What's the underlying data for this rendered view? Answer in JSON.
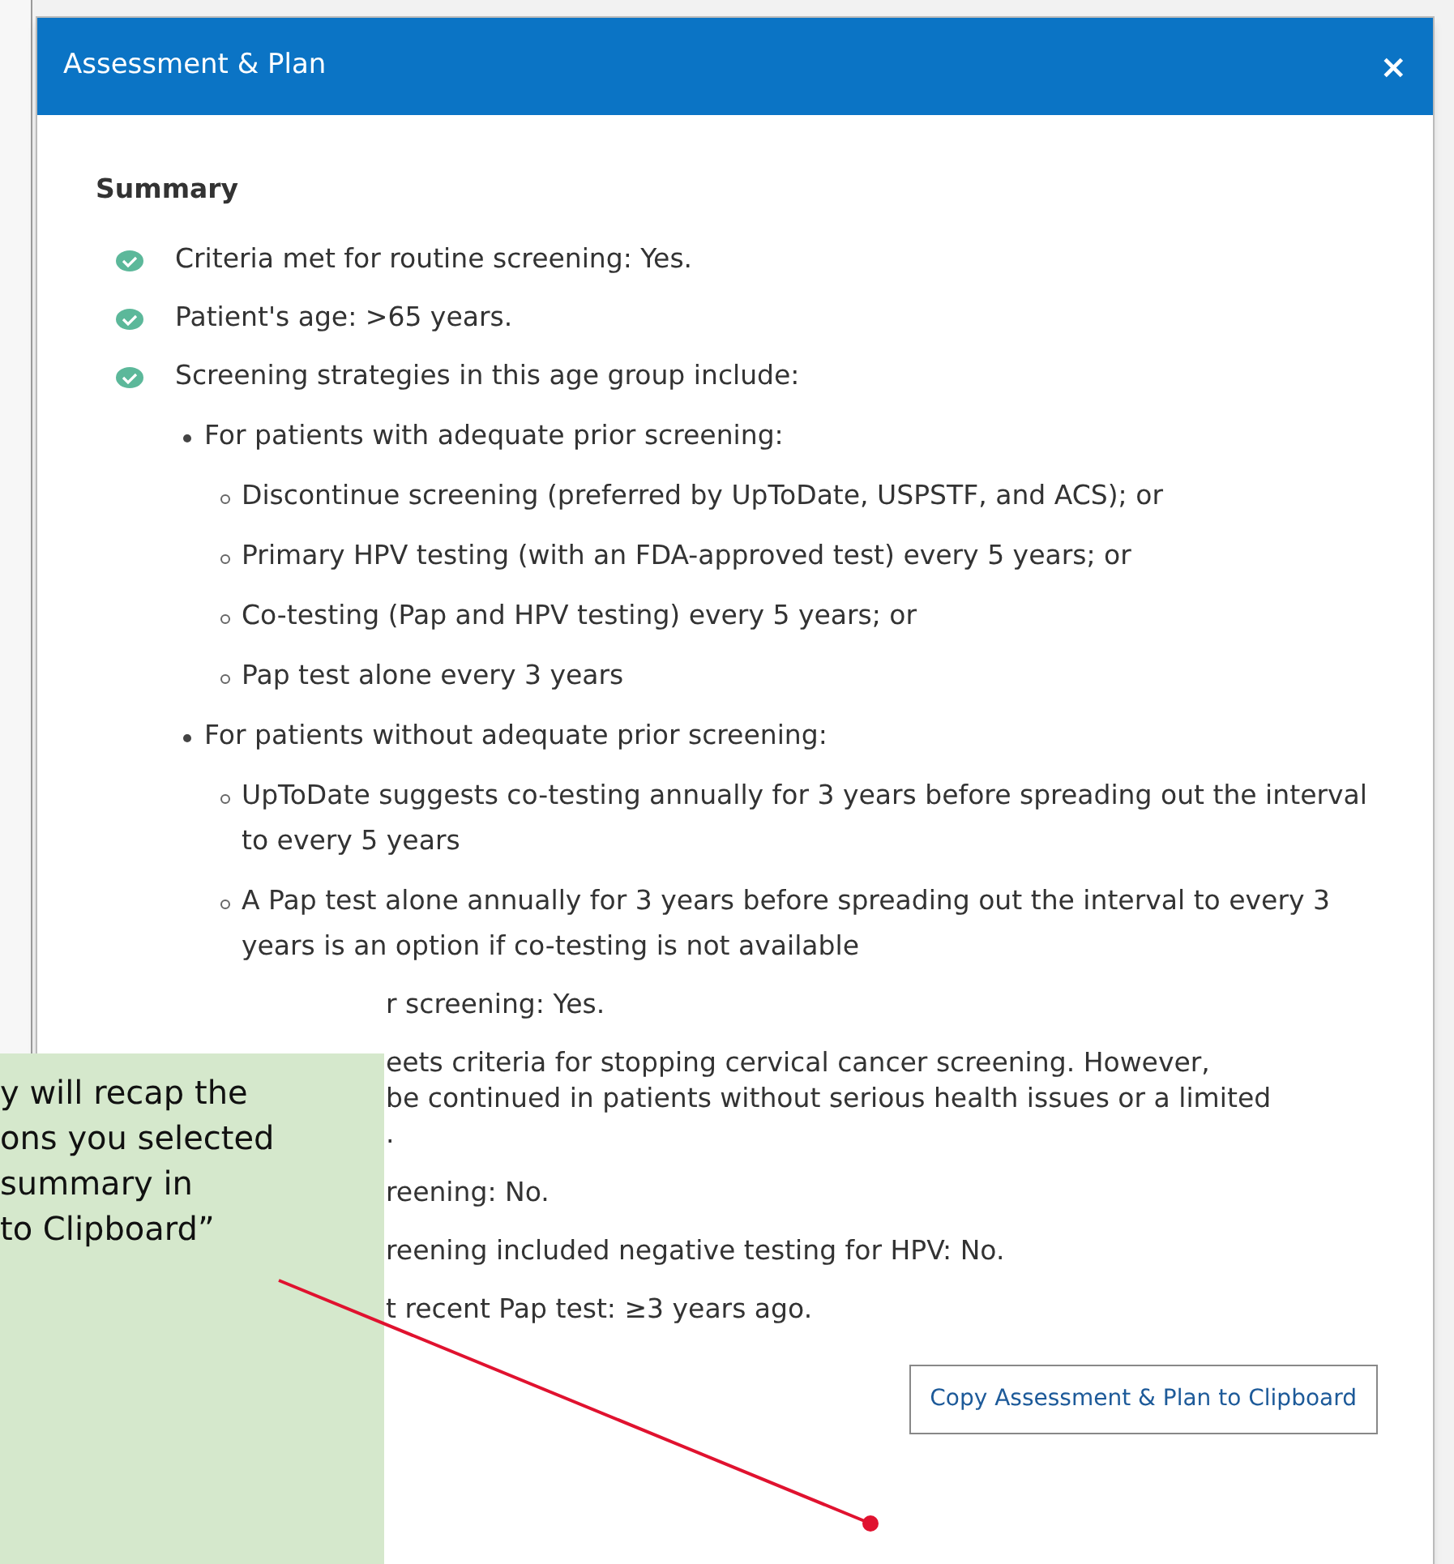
{
  "dialog": {
    "title": "Assessment & Plan",
    "close": "×"
  },
  "summary": {
    "heading": "Summary",
    "items": [
      {
        "text": "Criteria met for routine screening: Yes."
      },
      {
        "text": "Patient's age: >65 years."
      },
      {
        "text": "Screening strategies in this age group include:",
        "children": [
          {
            "text": "For patients with adequate prior screening:",
            "children": [
              {
                "text": "Discontinue screening (preferred by UpToDate, USPSTF, and ACS); or"
              },
              {
                "text": "Primary HPV testing (with an FDA-approved test) every 5 years; or"
              },
              {
                "text": "Co-testing (Pap and HPV testing) every 5 years; or"
              },
              {
                "text": "Pap test alone every 3 years"
              }
            ]
          },
          {
            "text": "For patients without adequate prior screening:",
            "children": [
              {
                "text": "UpToDate suggests co-testing annually for 3 years before spreading out the interval to every 5 years"
              },
              {
                "text": "A Pap test alone annually for 3 years before spreading out the interval to every 3 years is an option if co-testing is not available"
              }
            ]
          }
        ]
      },
      {
        "lines": [
          "r screening: Yes."
        ]
      },
      {
        "lines": [
          "eets criteria for stopping cervical cancer screening. However,",
          "be continued in patients without serious health issues or a limited",
          "."
        ]
      },
      {
        "lines": [
          "reening: No."
        ]
      },
      {
        "lines": [
          "reening included negative testing for HPV: No."
        ]
      },
      {
        "lines": [
          "t recent Pap test: ≥3 years ago."
        ]
      }
    ]
  },
  "copy_button": "Copy Assessment & Plan to Clipboard",
  "callout": {
    "lines": [
      "y will recap the",
      "ons you selected",
      "summary in",
      "to Clipboard”"
    ]
  }
}
